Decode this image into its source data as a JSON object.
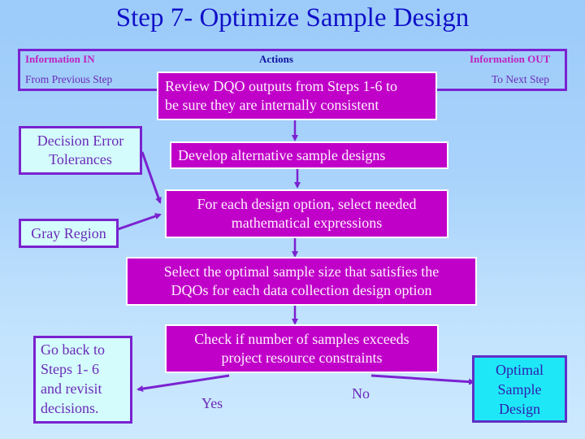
{
  "title": "Step 7- Optimize Sample Design",
  "header": {
    "info_in_label": "Information IN",
    "info_in_sub": "From Previous Step",
    "actions_label": "Actions",
    "info_out_label": "Information OUT",
    "info_out_sub": "To Next Step"
  },
  "inputs": {
    "decision_error": "Decision Error Tolerances",
    "gray_region": "Gray Region"
  },
  "actions": [
    {
      "line1": "Review DQO outputs from Steps 1-6 to",
      "line2": "be sure they are internally consistent"
    },
    {
      "line1": "Develop alternative sample designs"
    },
    {
      "line1": "For each design option, select needed",
      "line2": "mathematical expressions"
    },
    {
      "line1": "Select the optimal sample size that satisfies the",
      "line2": "DQOs for each data collection design option"
    },
    {
      "line1": "Check if number of samples exceeds",
      "line2": "project resource constraints"
    }
  ],
  "branches": {
    "yes": "Yes",
    "no": "No"
  },
  "go_back": {
    "lines": [
      "Go back to",
      "Steps 1- 6",
      "and revisit",
      "decisions."
    ]
  },
  "output": {
    "lines": [
      "Optimal",
      "Sample",
      "Design"
    ]
  },
  "colors": {
    "action_fill": "#c000c8",
    "arrow": "#7a22d0",
    "input_fill": "#d4fcfc",
    "output_fill": "#1ee8f8",
    "title": "#1010c8"
  }
}
